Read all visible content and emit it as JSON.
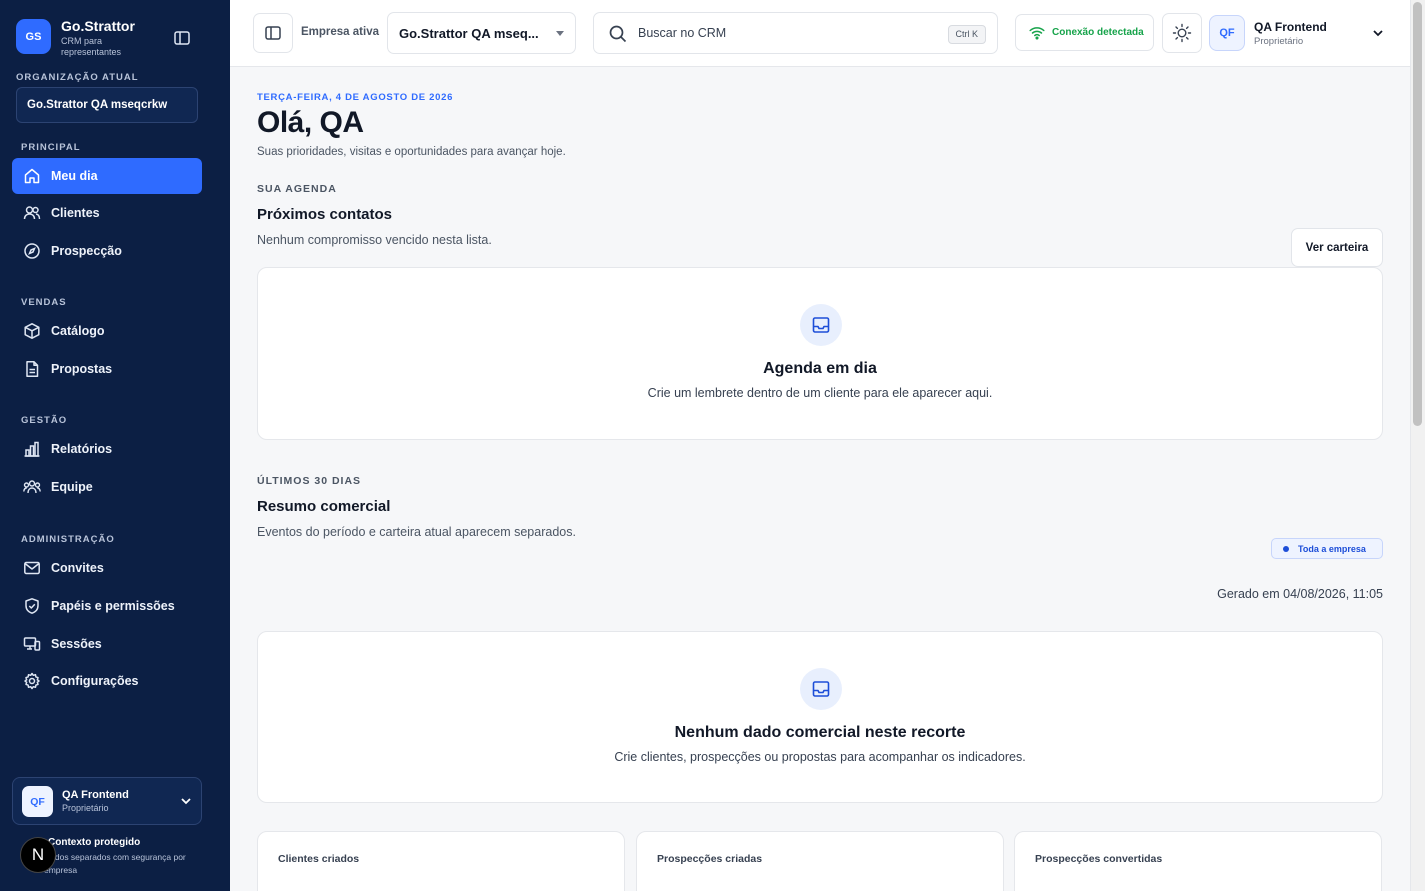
{
  "sidebar": {
    "brand": {
      "logo": "GS",
      "name": "Go.Strattor",
      "subtitle": "CRM para representantes"
    },
    "org_label": "ORGANIZAÇÃO ATUAL",
    "org_name": "Go.Strattor QA mseqcrkw",
    "sections": [
      {
        "label": "PRINCIPAL",
        "items": [
          {
            "label": "Meu dia",
            "icon": "home-icon",
            "active": true
          },
          {
            "label": "Clientes",
            "icon": "users-icon"
          },
          {
            "label": "Prospecção",
            "icon": "compass-icon"
          }
        ]
      },
      {
        "label": "VENDAS",
        "items": [
          {
            "label": "Catálogo",
            "icon": "box-icon"
          },
          {
            "label": "Propostas",
            "icon": "document-icon"
          }
        ]
      },
      {
        "label": "GESTÃO",
        "items": [
          {
            "label": "Relatórios",
            "icon": "bar-chart-icon"
          },
          {
            "label": "Equipe",
            "icon": "team-icon"
          }
        ]
      },
      {
        "label": "ADMINISTRAÇÃO",
        "items": [
          {
            "label": "Convites",
            "icon": "mail-icon"
          },
          {
            "label": "Papéis e permissões",
            "icon": "shield-icon"
          },
          {
            "label": "Sessões",
            "icon": "devices-icon"
          },
          {
            "label": "Configurações",
            "icon": "gear-icon"
          }
        ]
      }
    ],
    "user": {
      "initials": "QF",
      "name": "QA Frontend",
      "role": "Proprietário"
    },
    "context": {
      "title": "Contexto protegido",
      "subtitle": "Dados separados com segurança por empresa"
    },
    "dev_badge": "N"
  },
  "topbar": {
    "company_label": "Empresa ativa",
    "company_value": "Go.Strattor QA mseq...",
    "search_placeholder": "Buscar no CRM",
    "search_shortcut": "Ctrl K",
    "connection_status": "Conexão detectada",
    "user": {
      "initials": "QF",
      "name": "QA Frontend",
      "role": "Proprietário"
    }
  },
  "main": {
    "date": "TERÇA-FEIRA, 4 DE AGOSTO DE 2026",
    "greeting": "Olá, QA",
    "greeting_sub": "Suas prioridades, visitas e oportunidades para avançar hoje.",
    "agenda": {
      "eyebrow": "SUA AGENDA",
      "title": "Próximos contatos",
      "desc": "Nenhum compromisso vencido nesta lista.",
      "button": "Ver carteira",
      "empty_title": "Agenda em dia",
      "empty_desc": "Crie um lembrete dentro de um cliente para ele aparecer aqui."
    },
    "summary": {
      "eyebrow": "ÚLTIMOS 30 DIAS",
      "title": "Resumo comercial",
      "desc": "Eventos do período e carteira atual aparecem separados.",
      "scope_badge": "Toda a empresa",
      "generated": "Gerado em 04/08/2026, 11:05",
      "empty_title": "Nenhum dado comercial neste recorte",
      "empty_desc": "Crie clientes, prospecções ou propostas para acompanhar os indicadores."
    },
    "metrics": [
      {
        "label": "Clientes criados"
      },
      {
        "label": "Prospecções criadas"
      },
      {
        "label": "Prospecções convertidas"
      }
    ]
  },
  "colors": {
    "sidebar_bg": "#0c1f44",
    "accent": "#2f6bff",
    "success": "#16a34a"
  }
}
